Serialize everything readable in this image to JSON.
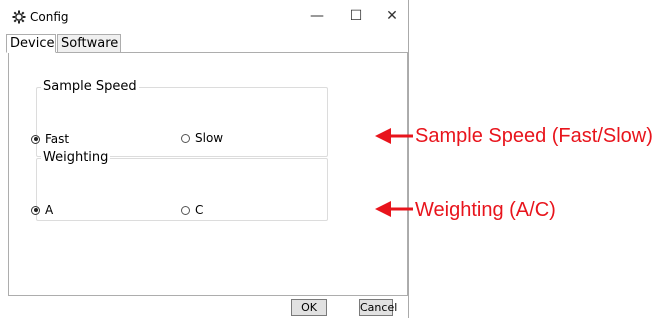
{
  "window": {
    "title": "Config",
    "icon": "gear-icon",
    "minimize": "—",
    "maximize": "☐",
    "close": "✕"
  },
  "tabs": [
    {
      "label": "Device",
      "selected": true
    },
    {
      "label": "Software",
      "selected": false
    }
  ],
  "sample_speed": {
    "legend": "Sample Speed",
    "options": [
      {
        "label": "Fast",
        "checked": true
      },
      {
        "label": "Slow",
        "checked": false
      }
    ]
  },
  "weighting": {
    "legend": "Weighting",
    "options": [
      {
        "label": "A",
        "checked": true
      },
      {
        "label": "C",
        "checked": false
      }
    ]
  },
  "buttons": {
    "ok": "OK",
    "cancel": "Cancel"
  },
  "annotations": {
    "speed": "Sample Speed (Fast/Slow)",
    "weighting": "Weighting (A/C)",
    "color": "#e8141c"
  }
}
